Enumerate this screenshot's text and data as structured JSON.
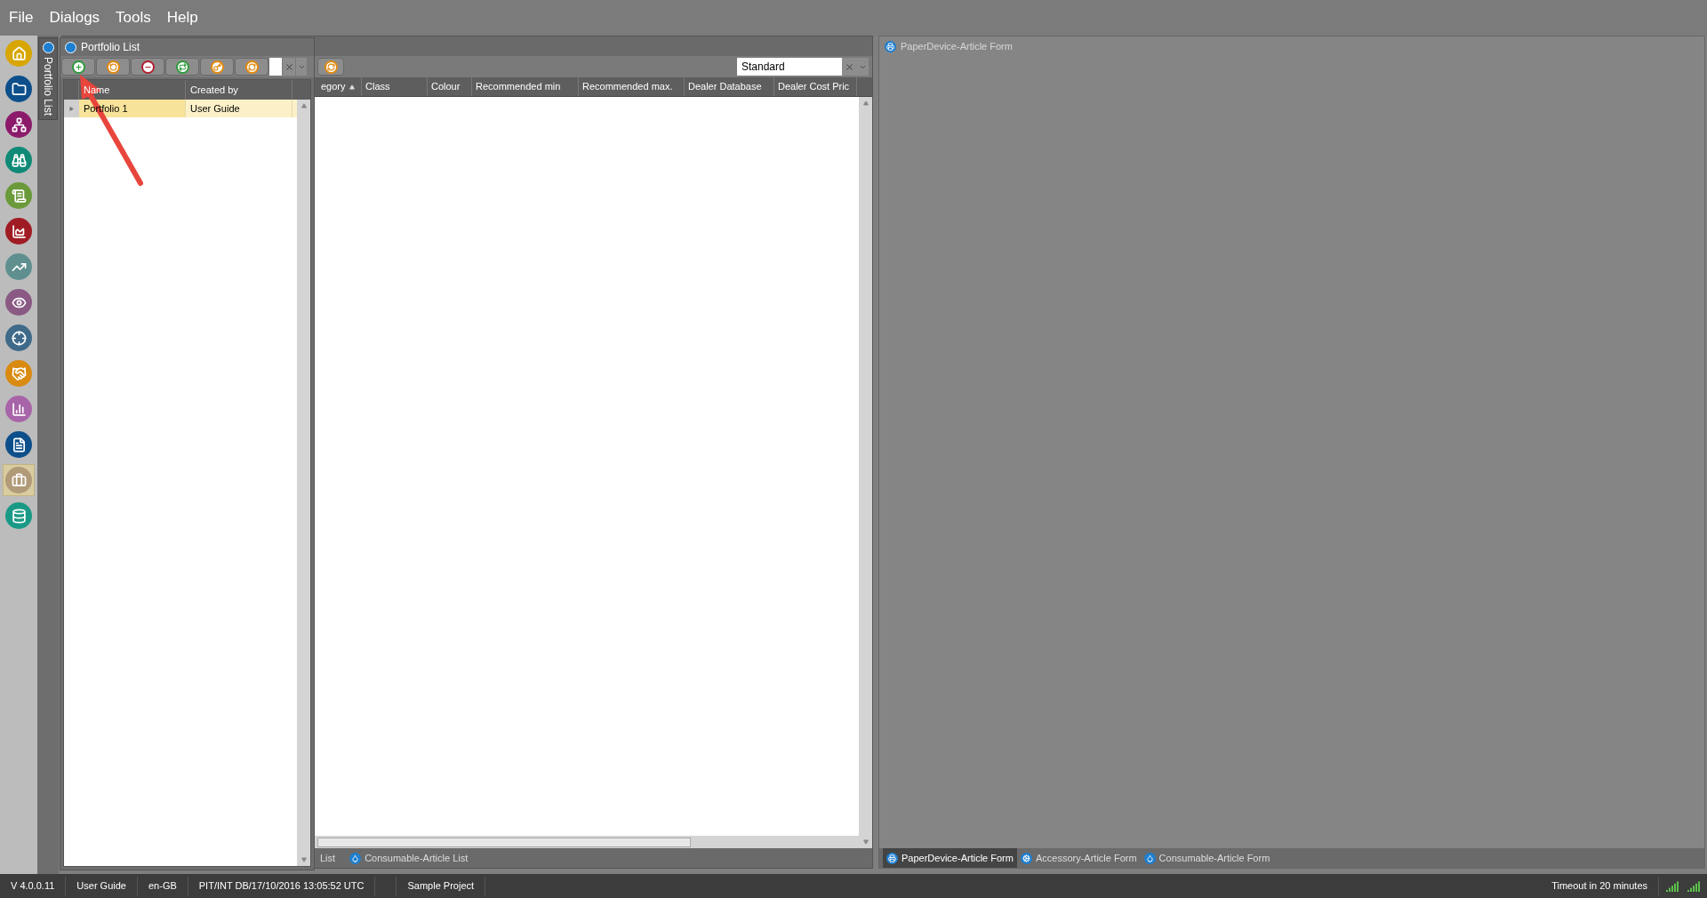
{
  "menu": [
    "File",
    "Dialogs",
    "Tools",
    "Help"
  ],
  "sidebar": {
    "items": [
      {
        "color": "#d7a600",
        "selected": false
      },
      {
        "color": "#0d4f8b",
        "selected": false
      },
      {
        "color": "#8b1a6b",
        "selected": false
      },
      {
        "color": "#0f8a77",
        "selected": false
      },
      {
        "color": "#6a9a3a",
        "selected": false
      },
      {
        "color": "#a01c24",
        "selected": false
      },
      {
        "color": "#5f8f8f",
        "selected": false
      },
      {
        "color": "#8a5a84",
        "selected": false
      },
      {
        "color": "#3f6a8a",
        "selected": false
      },
      {
        "color": "#d98a10",
        "selected": false
      },
      {
        "color": "#a864a8",
        "selected": false
      },
      {
        "color": "#0d4f8b",
        "selected": false
      },
      {
        "color": "#b09a78",
        "selected": true
      },
      {
        "color": "#1a9a86",
        "selected": false
      }
    ]
  },
  "dock_tabs": [
    {
      "label": "Portfolio List",
      "selected": true
    }
  ],
  "portfolio_list": {
    "title": "Portfolio List",
    "columns": [
      "Name",
      "Created by"
    ],
    "rows": [
      {
        "cells": [
          "Portfolio 1",
          "User Guide"
        ],
        "selected": true
      }
    ]
  },
  "article_list": {
    "layout": {
      "value": "Standard"
    },
    "columns": [
      {
        "label": "egory",
        "sorted": true
      },
      {
        "label": "Class"
      },
      {
        "label": "Colour"
      },
      {
        "label": "Recommended min"
      },
      {
        "label": "Recommended max."
      },
      {
        "label": "Dealer Database"
      },
      {
        "label": "Dealer Cost Pric"
      }
    ],
    "tabs": [
      {
        "label": "List",
        "selected": false
      },
      {
        "label": "Consumable-Article List",
        "selected": false
      }
    ]
  },
  "form_panel": {
    "title": "PaperDevice-Article Form",
    "tabs": [
      {
        "label": "PaperDevice-Article Form",
        "selected": true
      },
      {
        "label": "Accessory-Article Form",
        "selected": false
      },
      {
        "label": "Consumable-Article Form",
        "selected": false
      }
    ]
  },
  "status_bar": {
    "items": [
      "V 4.0.0.11",
      "User Guide",
      "en-GB",
      "PIT/INT DB/17/10/2016 13:05:52 UTC",
      "Sample Project"
    ],
    "timeout": "Timeout in 20 minutes"
  }
}
